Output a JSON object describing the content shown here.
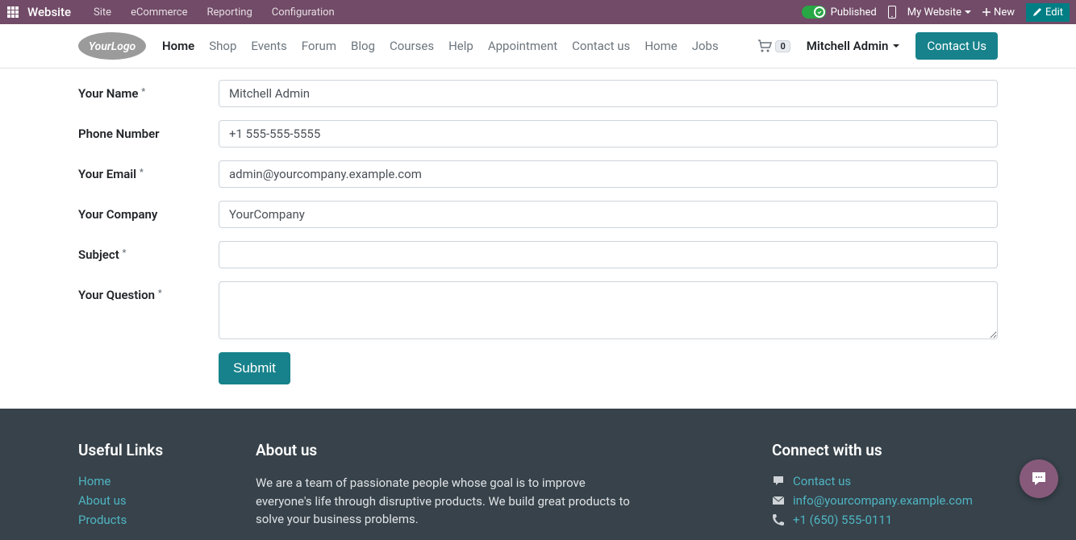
{
  "admin": {
    "brand": "Website",
    "menus": [
      "Site",
      "eCommerce",
      "Reporting",
      "Configuration"
    ],
    "published": "Published",
    "my_website": "My Website",
    "new": "New",
    "edit": "Edit"
  },
  "header": {
    "nav": [
      "Home",
      "Shop",
      "Events",
      "Forum",
      "Blog",
      "Courses",
      "Help",
      "Appointment",
      "Contact us",
      "Home",
      "Jobs"
    ],
    "active_index": 0,
    "cart_count": "0",
    "user": "Mitchell Admin",
    "contact_btn": "Contact Us"
  },
  "form": {
    "fields": {
      "name": {
        "label": "Your Name",
        "value": "Mitchell Admin",
        "required": true
      },
      "phone": {
        "label": "Phone Number",
        "value": "+1 555-555-5555",
        "required": false
      },
      "email": {
        "label": "Your Email",
        "value": "admin@yourcompany.example.com",
        "required": true
      },
      "company": {
        "label": "Your Company",
        "value": "YourCompany",
        "required": false
      },
      "subject": {
        "label": "Subject",
        "value": "",
        "required": true
      },
      "question": {
        "label": "Your Question",
        "value": "",
        "required": true
      }
    },
    "submit": "Submit"
  },
  "footer": {
    "useful_title": "Useful Links",
    "useful_links": [
      "Home",
      "About us",
      "Products"
    ],
    "about_title": "About us",
    "about_text": "We are a team of passionate people whose goal is to improve everyone's life through disruptive products. We build great products to solve your business problems.",
    "connect_title": "Connect with us",
    "connect": {
      "contact": "Contact us",
      "email": "info@yourcompany.example.com",
      "phone": "+1 (650) 555-0111"
    }
  }
}
